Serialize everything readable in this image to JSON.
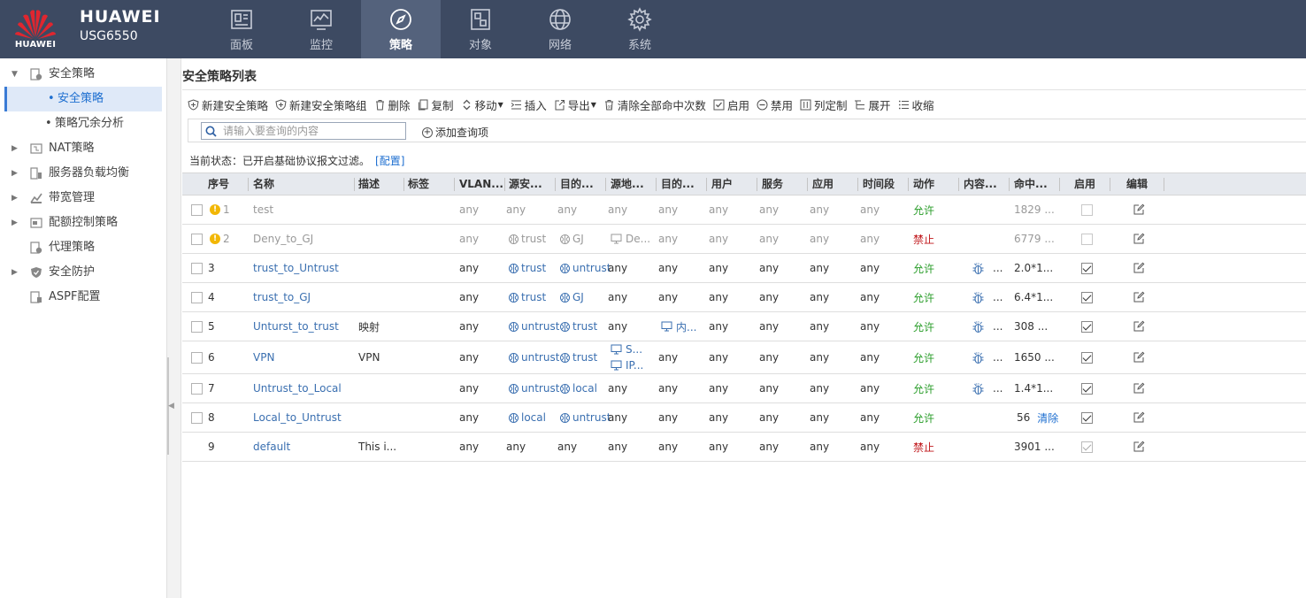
{
  "brand": {
    "logo_word": "HUAWEI",
    "title": "HUAWEI",
    "model": "USG6550"
  },
  "nav": [
    {
      "label": "面板",
      "icon": "dashboard-icon",
      "active": false
    },
    {
      "label": "监控",
      "icon": "monitor-icon",
      "active": false
    },
    {
      "label": "策略",
      "icon": "compass-icon",
      "active": true
    },
    {
      "label": "对象",
      "icon": "object-icon",
      "active": false
    },
    {
      "label": "网络",
      "icon": "globe-icon",
      "active": false
    },
    {
      "label": "系统",
      "icon": "gear-icon",
      "active": false
    }
  ],
  "sidebar": {
    "items": [
      {
        "label": "安全策略",
        "expanded": true,
        "children": [
          {
            "label": "安全策略",
            "active": true
          },
          {
            "label": "策略冗余分析",
            "active": false
          }
        ]
      },
      {
        "label": "NAT策略",
        "expanded": false
      },
      {
        "label": "服务器负载均衡",
        "expanded": false
      },
      {
        "label": "带宽管理",
        "expanded": false
      },
      {
        "label": "配额控制策略",
        "expanded": false
      },
      {
        "label": "代理策略",
        "expanded": null
      },
      {
        "label": "安全防护",
        "expanded": false
      },
      {
        "label": "ASPF配置",
        "expanded": null
      }
    ]
  },
  "page": {
    "title": "安全策略列表",
    "toolbar": {
      "new_policy": "新建安全策略",
      "new_group": "新建安全策略组",
      "delete": "删除",
      "copy": "复制",
      "move": "移动",
      "insert": "插入",
      "export": "导出",
      "clear_hits": "清除全部命中次数",
      "enable": "启用",
      "disable": "禁用",
      "columns": "列定制",
      "expand": "展开",
      "collapse": "收缩"
    },
    "search": {
      "placeholder": "请输入要查询的内容",
      "add_query": "添加查询项"
    },
    "status": {
      "text": "当前状态：已开启基础协议报文过滤。",
      "link": "[配置]"
    }
  },
  "table": {
    "headers": {
      "seq": "序号",
      "name": "名称",
      "desc": "描述",
      "tag": "标签",
      "vlan": "VLAN...",
      "src_zone": "源安...",
      "dst_zone": "目的...",
      "src_addr": "源地...",
      "dst_addr": "目的...",
      "user": "用户",
      "service": "服务",
      "app": "应用",
      "time": "时间段",
      "action": "动作",
      "content": "内容...",
      "hits": "命中...",
      "enable": "启用",
      "edit": "编辑"
    },
    "rows": [
      {
        "seq": "1",
        "name": "test",
        "desc": "",
        "vlan": "any",
        "src_zone": "any",
        "dst_zone": "any",
        "src_addr": "any",
        "dst_addr": "any",
        "user": "any",
        "service": "any",
        "app": "any",
        "time": "any",
        "action": "允许",
        "content": "",
        "hits": "1829 ...",
        "enabled": false
      },
      {
        "seq": "2",
        "name": "Deny_to_GJ",
        "desc": "",
        "vlan": "any",
        "src_zone": "trust",
        "dst_zone": "GJ",
        "src_addr": "De...",
        "dst_addr": "any",
        "user": "any",
        "service": "any",
        "app": "any",
        "time": "any",
        "action": "禁止",
        "content": "",
        "hits": "6779 ...",
        "enabled": false
      },
      {
        "seq": "3",
        "name": "trust_to_Untrust",
        "desc": "",
        "vlan": "any",
        "src_zone": "trust",
        "dst_zone": "untrust",
        "src_addr": "any",
        "dst_addr": "any",
        "user": "any",
        "service": "any",
        "app": "any",
        "time": "any",
        "action": "允许",
        "content": "...",
        "hits": "2.0*1...",
        "enabled": true
      },
      {
        "seq": "4",
        "name": "trust_to_GJ",
        "desc": "",
        "vlan": "any",
        "src_zone": "trust",
        "dst_zone": "GJ",
        "src_addr": "any",
        "dst_addr": "any",
        "user": "any",
        "service": "any",
        "app": "any",
        "time": "any",
        "action": "允许",
        "content": "...",
        "hits": "6.4*1...",
        "enabled": true
      },
      {
        "seq": "5",
        "name": "Unturst_to_trust",
        "desc": "映射",
        "vlan": "any",
        "src_zone": "untrust",
        "dst_zone": "trust",
        "src_addr": "any",
        "dst_addr": "内...",
        "user": "any",
        "service": "any",
        "app": "any",
        "time": "any",
        "action": "允许",
        "content": "...",
        "hits": "308 ...",
        "enabled": true
      },
      {
        "seq": "6",
        "name": "VPN",
        "desc": "VPN",
        "vlan": "any",
        "src_zone": "untrust",
        "dst_zone": "trust",
        "src_addr_lines": [
          "S...",
          "IP..."
        ],
        "dst_addr": "any",
        "user": "any",
        "service": "any",
        "app": "any",
        "time": "any",
        "action": "允许",
        "content": "...",
        "hits": "1650 ...",
        "enabled": true
      },
      {
        "seq": "7",
        "name": "Untrust_to_Local",
        "desc": "",
        "vlan": "any",
        "src_zone": "untrust",
        "dst_zone": "local",
        "src_addr": "any",
        "dst_addr": "any",
        "user": "any",
        "service": "any",
        "app": "any",
        "time": "any",
        "action": "允许",
        "content": "...",
        "hits": "1.4*1...",
        "enabled": true
      },
      {
        "seq": "8",
        "name": "Local_to_Untrust",
        "desc": "",
        "vlan": "any",
        "src_zone": "local",
        "dst_zone": "untrust",
        "src_addr": "any",
        "dst_addr": "any",
        "user": "any",
        "service": "any",
        "app": "any",
        "time": "any",
        "action": "允许",
        "content": "",
        "hits": "56",
        "hits_clear": "清除",
        "enabled": true
      },
      {
        "seq": "9",
        "name": "default",
        "desc": "This i...",
        "vlan": "any",
        "src_zone": "any",
        "dst_zone": "any",
        "src_addr": "any",
        "dst_addr": "any",
        "user": "any",
        "service": "any",
        "app": "any",
        "time": "any",
        "action": "禁止",
        "content": "",
        "hits": "3901 ...",
        "enabled": true
      }
    ]
  },
  "colors": {
    "topbar": "#3d4a62",
    "nav_active": "#54627c",
    "link": "#3a6fb0",
    "allow": "#2a9d2a",
    "deny": "#c0171b",
    "warning": "#f2b705"
  }
}
